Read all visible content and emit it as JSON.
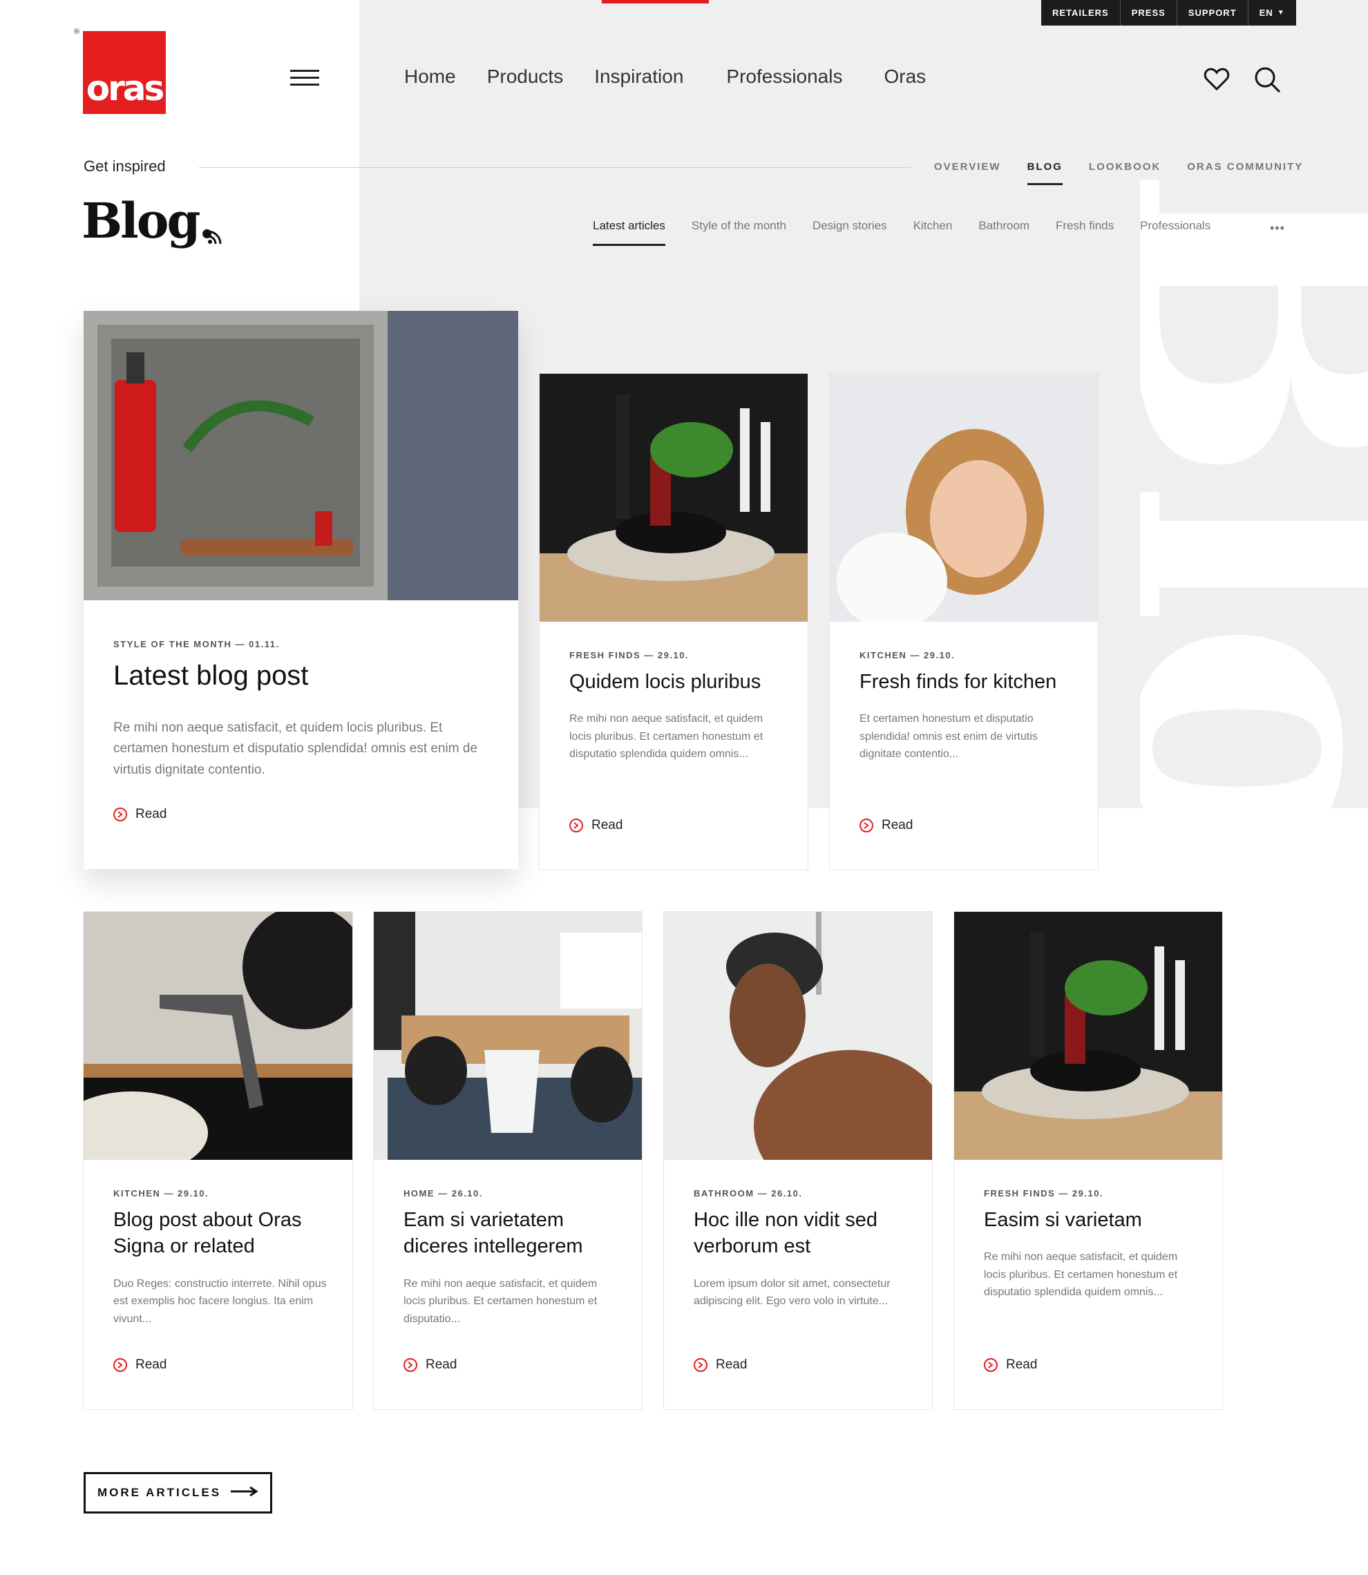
{
  "util_bar": {
    "retailers": "RETAILERS",
    "press": "PRESS",
    "support": "SUPPORT",
    "lang": "EN"
  },
  "logo": {
    "text": "oras",
    "reg": "®"
  },
  "main_nav": [
    "Home",
    "Products",
    "Inspiration",
    "Professionals",
    "Oras"
  ],
  "breadcrumb": "Get inspired",
  "sub_nav": [
    "OVERVIEW",
    "BLOG",
    "LOOKBOOK",
    "ORAS COMMUNITY"
  ],
  "page_title": "Blog.",
  "watermark": "Blog",
  "categories": [
    "Latest articles",
    "Style of the month",
    "Design stories",
    "Kitchen",
    "Bathroom",
    "Fresh finds",
    "Professionals"
  ],
  "more_dots": "•••",
  "cards": [
    {
      "meta": "STYLE OF THE MONTH — 01.11.",
      "title": "Latest blog post",
      "excerpt": "Re mihi non aeque satisfacit, et quidem locis pluribus. Et certamen honestum et disputatio splendida! omnis est enim de virtutis dignitate contentio.",
      "read": "Read"
    },
    {
      "meta": "FRESH FINDS — 29.10.",
      "title": "Quidem locis pluribus",
      "excerpt": "Re mihi non aeque satisfacit, et quidem locis pluribus. Et certamen honestum et disputatio splendida quidem omnis...",
      "read": "Read"
    },
    {
      "meta": "KITCHEN — 29.10.",
      "title": "Fresh finds for kitchen",
      "excerpt": "Et certamen honestum et disputatio splendida! omnis est enim de virtutis dignitate contentio...",
      "read": "Read"
    },
    {
      "meta": "KITCHEN — 29.10.",
      "title": "Blog post about Oras Signa or related",
      "excerpt": "Duo Reges: constructio interrete. Nihil opus est exemplis hoc facere longius. Ita enim vivunt...",
      "read": "Read"
    },
    {
      "meta": "HOME — 26.10.",
      "title": "Eam si varietatem diceres intellegerem",
      "excerpt": "Re mihi non aeque satisfacit, et quidem locis pluribus. Et certamen honestum et disputatio...",
      "read": "Read"
    },
    {
      "meta": "BATHROOM — 26.10.",
      "title": "Hoc ille non vidit sed verborum est",
      "excerpt": "Lorem ipsum dolor sit amet, consectetur adipiscing elit. Ego vero volo in virtute...",
      "read": "Read"
    },
    {
      "meta": "FRESH FINDS — 29.10.",
      "title": "Easim si varietam",
      "excerpt": "Re mihi non aeque satisfacit, et quidem locis pluribus. Et certamen honestum et disputatio splendida quidem omnis...",
      "read": "Read"
    }
  ],
  "more_button": "MORE ARTICLES",
  "colors": {
    "accent": "#e41e1e",
    "grey_bg": "#efefef",
    "dark": "#1c1c1c"
  }
}
